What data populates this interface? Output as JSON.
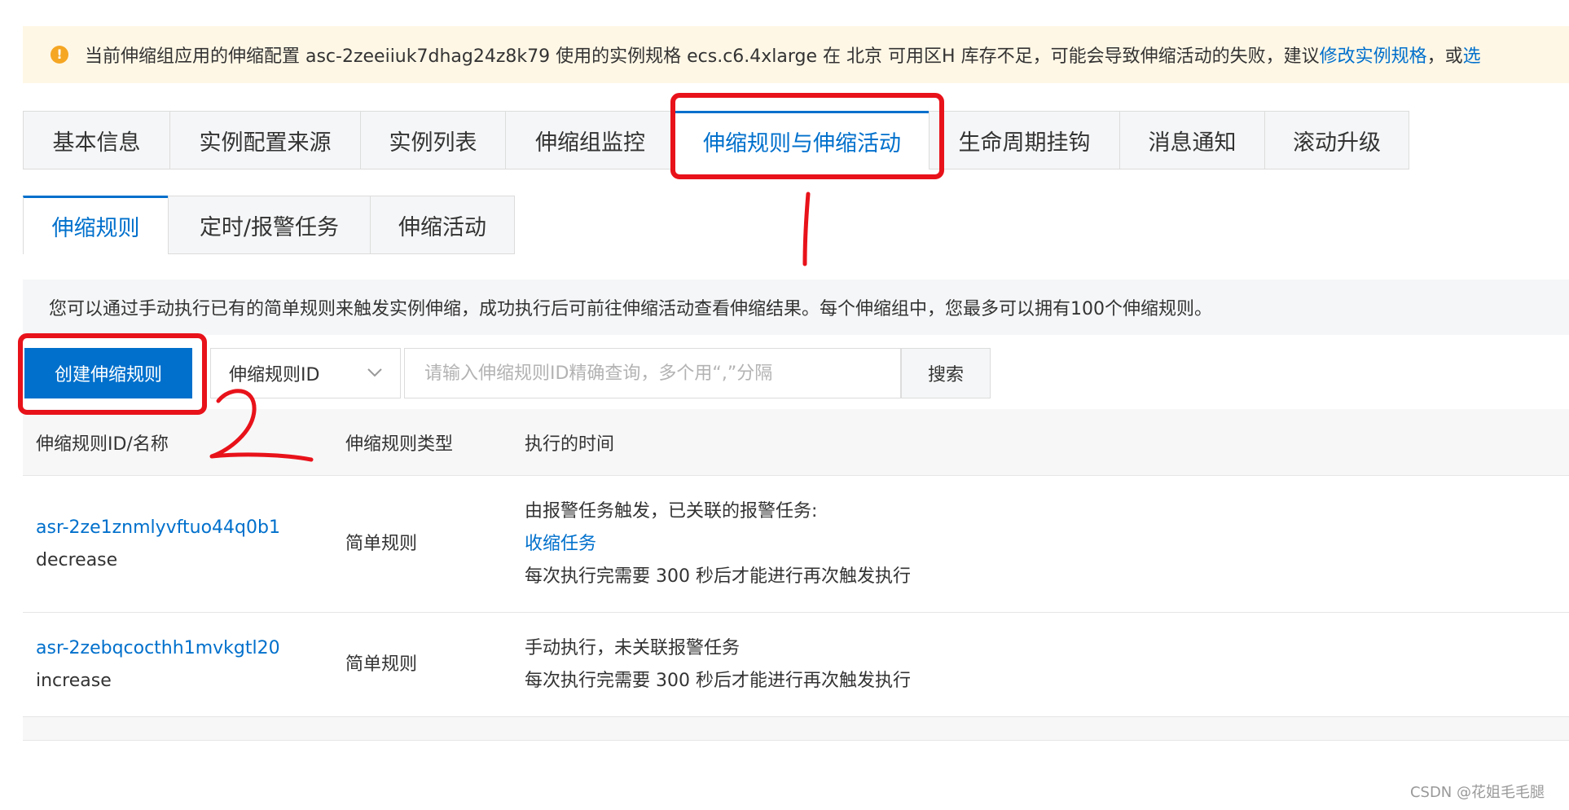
{
  "banner": {
    "icon": "warning-icon",
    "text": "当前伸缩组应用的伸缩配置 asc-2zeeiiuk7dhag24z8k79 使用的实例规格 ecs.c6.4xlarge 在 北京 可用区H 库存不足，可能会导致伸缩活动的失败，建议",
    "link1": "修改实例规格",
    "sep": "，或",
    "link2": "选"
  },
  "primary_tabs": [
    {
      "label": "基本信息"
    },
    {
      "label": "实例配置来源"
    },
    {
      "label": "实例列表"
    },
    {
      "label": "伸缩组监控"
    },
    {
      "label": "伸缩规则与伸缩活动"
    },
    {
      "label": "生命周期挂钩"
    },
    {
      "label": "消息通知"
    },
    {
      "label": "滚动升级"
    }
  ],
  "secondary_tabs": [
    {
      "label": "伸缩规则"
    },
    {
      "label": "定时/报警任务"
    },
    {
      "label": "伸缩活动"
    }
  ],
  "info_text": "您可以通过手动执行已有的简单规则来触发实例伸缩，成功执行后可前往伸缩活动查看伸缩结果。每个伸缩组中，您最多可以拥有100个伸缩规则。",
  "toolbar": {
    "create_label": "创建伸缩规则",
    "select_value": "伸缩规则ID",
    "search_placeholder": "请输入伸缩规则ID精确查询，多个用“,”分隔",
    "search_label": "搜索"
  },
  "table": {
    "columns": [
      "伸缩规则ID/名称",
      "伸缩规则类型",
      "执行的时间"
    ],
    "rows": [
      {
        "id": "asr-2ze1znmlyvftuo44q0b1",
        "name": "decrease",
        "type": "简单规则",
        "time_line1": "由报警任务触发，已关联的报警任务:",
        "time_link": "收缩任务",
        "time_line3": "每次执行完需要 300 秒后才能进行再次触发执行"
      },
      {
        "id": "asr-2zebqcocthh1mvkgtl20",
        "name": "increase",
        "type": "简单规则",
        "time_line1": "手动执行，未关联报警任务",
        "time_line2": "每次执行完需要 300 秒后才能进行再次触发执行"
      }
    ]
  },
  "annotation": {
    "step2": "2",
    "color": "#e8121a"
  },
  "watermark": "CSDN @花姐毛毛腿",
  "colors": {
    "accent": "#0070cc",
    "banner_bg": "#fff7e6",
    "warning": "#f5a623"
  }
}
